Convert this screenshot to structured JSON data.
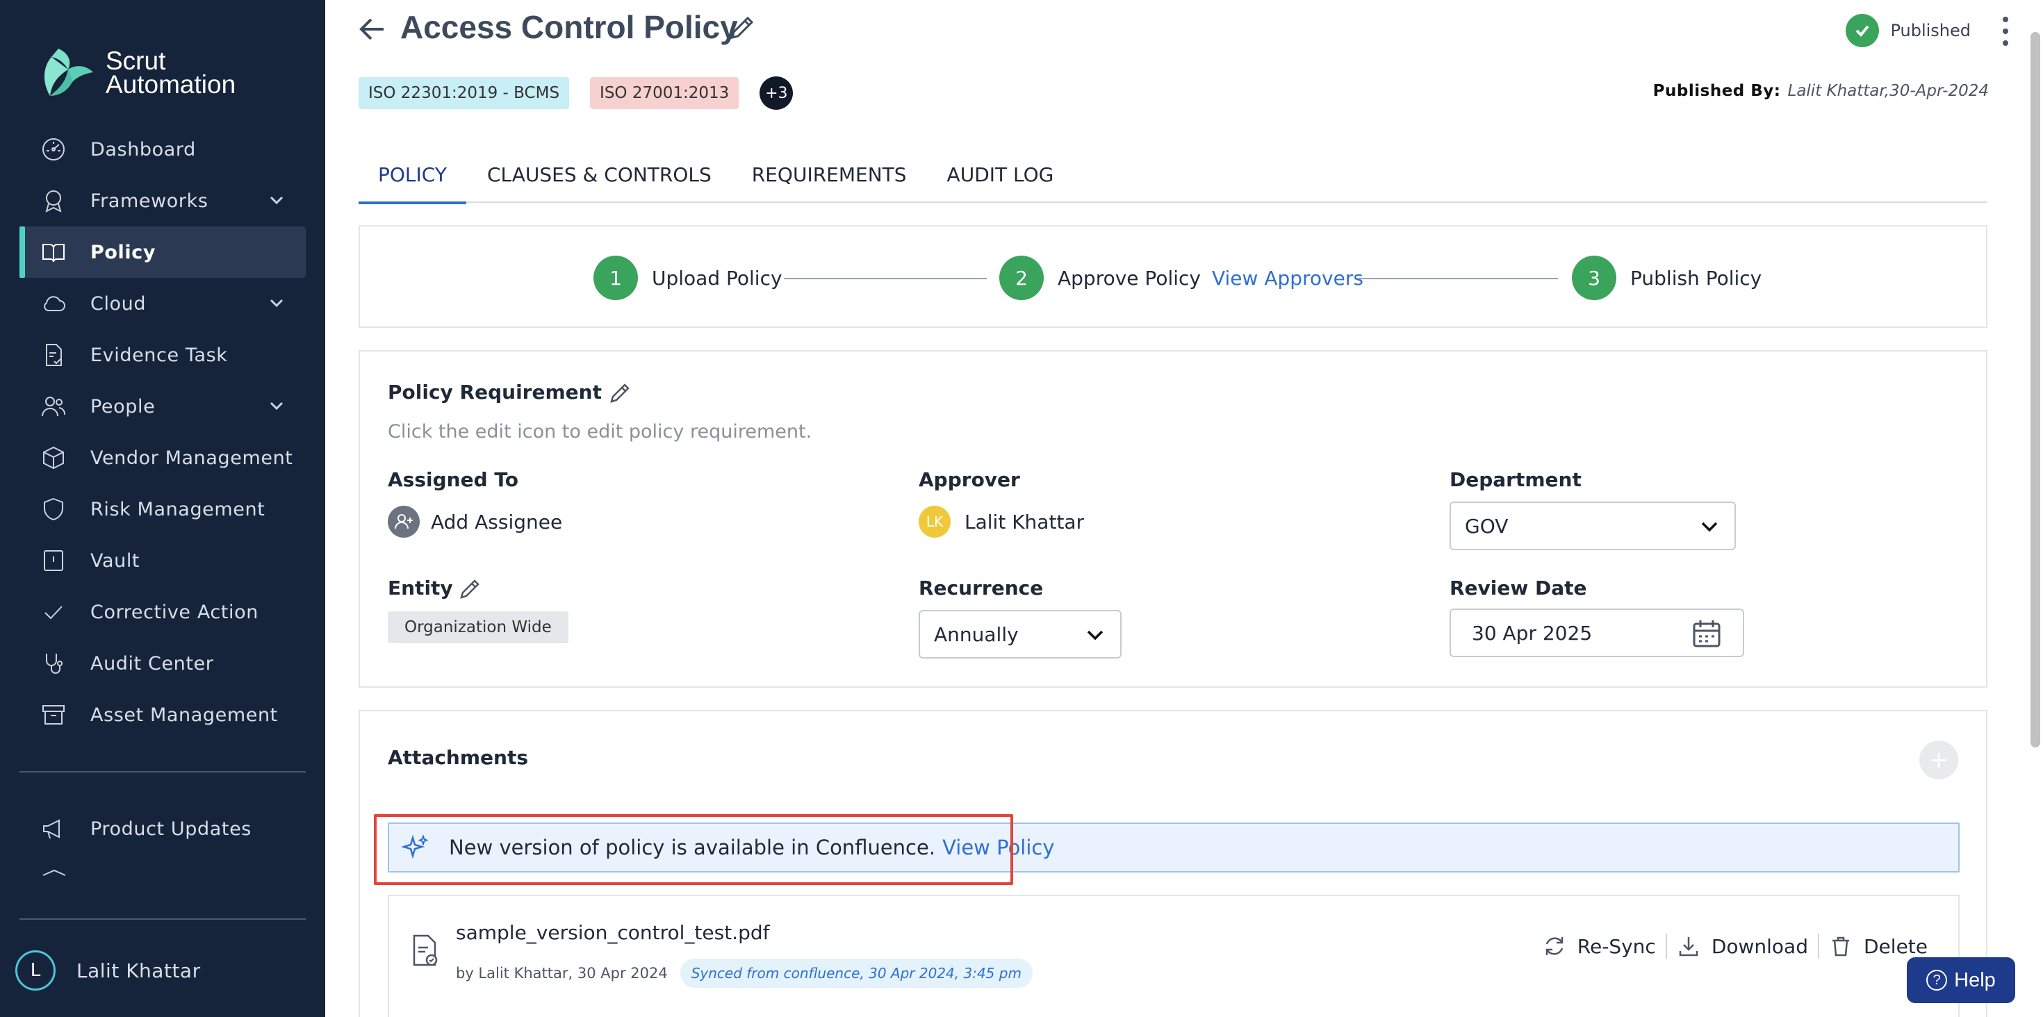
{
  "brand": {
    "line1": "Scrut",
    "line2": "Automation"
  },
  "sidebar": {
    "items": [
      {
        "label": "Dashboard",
        "icon": "dashboard-icon"
      },
      {
        "label": "Frameworks",
        "icon": "award-icon",
        "expandable": true
      },
      {
        "label": "Policy",
        "icon": "book-icon",
        "active": true
      },
      {
        "label": "Cloud",
        "icon": "cloud-icon",
        "expandable": true
      },
      {
        "label": "Evidence Task",
        "icon": "file-check-icon"
      },
      {
        "label": "People",
        "icon": "users-icon",
        "expandable": true
      },
      {
        "label": "Vendor Management",
        "icon": "package-icon"
      },
      {
        "label": "Risk Management",
        "icon": "shield-icon"
      },
      {
        "label": "Vault",
        "icon": "vault-icon"
      },
      {
        "label": "Corrective Action",
        "icon": "check-icon"
      },
      {
        "label": "Audit Center",
        "icon": "stethoscope-icon"
      },
      {
        "label": "Asset Management",
        "icon": "archive-icon"
      }
    ],
    "extra_items": [
      {
        "label": "Product Updates",
        "icon": "megaphone-icon"
      }
    ],
    "user": {
      "initial": "L",
      "name": "Lalit Khattar"
    }
  },
  "header": {
    "title": "Access Control Policy",
    "status": "Published",
    "tags": [
      "ISO 22301:2019 - BCMS",
      "ISO 27001:2013"
    ],
    "more_tags": "+3",
    "published_by_label": "Published By:",
    "published_by_value": "Lalit Khattar,30-Apr-2024"
  },
  "tabs": [
    "POLICY",
    "CLAUSES & CONTROLS",
    "REQUIREMENTS",
    "AUDIT LOG"
  ],
  "stepper": {
    "steps": [
      {
        "num": "1",
        "label": "Upload Policy"
      },
      {
        "num": "2",
        "label": "Approve Policy",
        "link": "View Approvers"
      },
      {
        "num": "3",
        "label": "Publish Policy"
      }
    ]
  },
  "requirement": {
    "title": "Policy Requirement",
    "hint": "Click the edit icon to edit policy requirement.",
    "assigned_label": "Assigned To",
    "assignee_text": "Add Assignee",
    "approver_label": "Approver",
    "approver_initials": "LK",
    "approver_name": "Lalit Khattar",
    "department_label": "Department",
    "department_value": "GOV",
    "entity_label": "Entity",
    "entity_value": "Organization Wide",
    "recurrence_label": "Recurrence",
    "recurrence_value": "Annually",
    "review_label": "Review Date",
    "review_value": "30 Apr 2025"
  },
  "attachments": {
    "title": "Attachments",
    "add_label": "+",
    "banner_text": "New version of policy is available in Confluence.",
    "banner_link": "View Policy",
    "file": {
      "name": "sample_version_control_test.pdf",
      "by": "by Lalit Khattar, 30 Apr 2024",
      "sync": "Synced from confluence, 30 Apr 2024, 3:45 pm",
      "actions": [
        "Re-Sync",
        "Download",
        "Delete"
      ]
    }
  },
  "help": {
    "label": "Help",
    "glyph": "?"
  },
  "colors": {
    "sidebar": "#16243b",
    "accent": "#4fd1c5",
    "link": "#2f6fd1",
    "success": "#3aa35c",
    "highlight": "#e0463a"
  }
}
